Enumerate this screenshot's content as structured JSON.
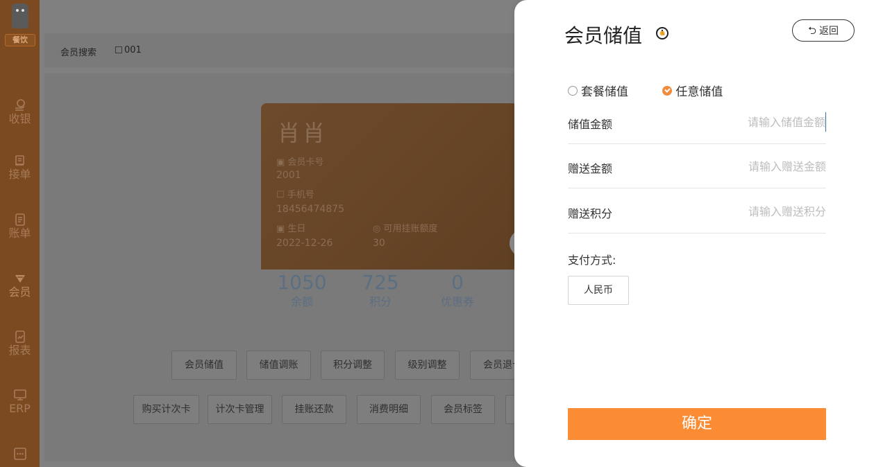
{
  "sidebar": {
    "logo_text": "餐饮",
    "items": [
      {
        "label": "收银",
        "icon": "cashier-icon"
      },
      {
        "label": "接单",
        "icon": "order-icon"
      },
      {
        "label": "账单",
        "icon": "bill-icon"
      },
      {
        "label": "会员",
        "icon": "member-icon"
      },
      {
        "label": "报表",
        "icon": "report-icon"
      },
      {
        "label": "ERP",
        "icon": "monitor-icon"
      },
      {
        "label": "",
        "icon": "more-icon"
      }
    ]
  },
  "main": {
    "search": {
      "label": "会员搜索",
      "value": "001"
    },
    "card": {
      "name": "肖肖",
      "card_no_label": "会员卡号",
      "card_no": "2001",
      "phone_label": "手机号",
      "phone": "18456474875",
      "birthday_label": "生日",
      "birthday": "2022-12-26",
      "credit_label": "可用挂账额度",
      "credit": "30",
      "stats": [
        {
          "value": "1050",
          "label": "余额"
        },
        {
          "value": "725",
          "label": "积分"
        },
        {
          "value": "0",
          "label": "优惠券"
        }
      ]
    },
    "actions_row1": [
      "会员储值",
      "储值调账",
      "积分调整",
      "级别调整",
      "会员退卡"
    ],
    "actions_row2": [
      "购买计次卡",
      "计次卡管理",
      "挂账还款",
      "消费明细",
      "会员标签"
    ]
  },
  "drawer": {
    "title": "会员储值",
    "back_label": "返回",
    "radio_options": [
      {
        "label": "套餐储值",
        "checked": false
      },
      {
        "label": "任意储值",
        "checked": true
      }
    ],
    "fields": [
      {
        "label": "储值金额",
        "placeholder": "请输入储值金额"
      },
      {
        "label": "赠送金额",
        "placeholder": "请输入赠送金额"
      },
      {
        "label": "赠送积分",
        "placeholder": "请输入赠送积分"
      }
    ],
    "payment_label": "支付方式:",
    "payment_option": "人民币",
    "confirm_label": "确定",
    "accent_color": "#fb8c34"
  }
}
